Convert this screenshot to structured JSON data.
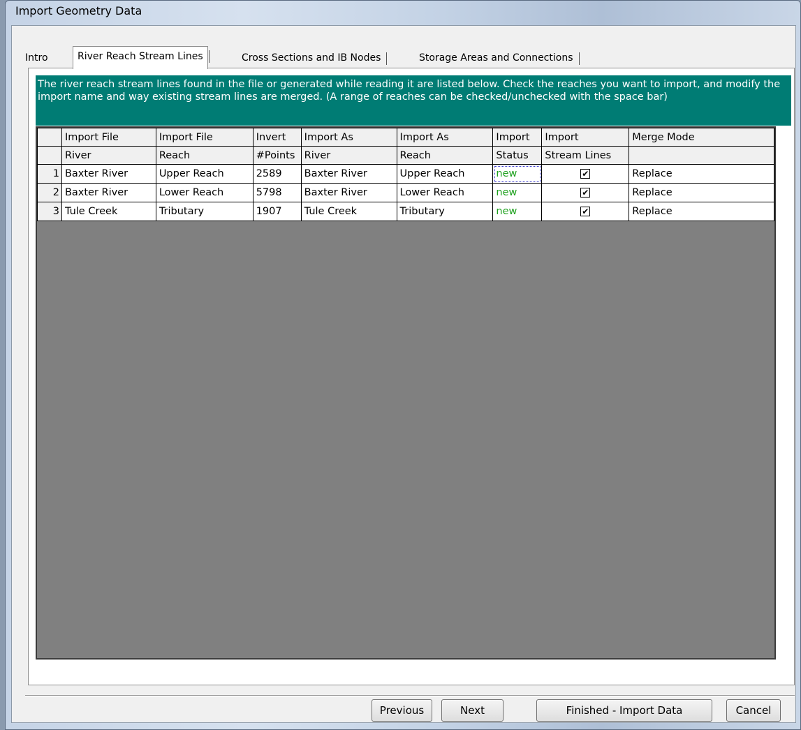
{
  "window": {
    "title": "Import Geometry Data"
  },
  "tabs": [
    {
      "label": "Intro"
    },
    {
      "label": "River Reach Stream Lines"
    },
    {
      "label": "Cross Sections and IB Nodes"
    },
    {
      "label": "Storage Areas and Connections"
    }
  ],
  "description": "The river reach stream lines found in the file or generated while reading it are listed below.  Check the reaches you want to import, and modify the import name and way existing stream lines are merged.  (A range of reaches can be checked/unchecked with the space bar)",
  "table": {
    "header1": [
      "Import File",
      "Import File",
      "Invert",
      "Import As",
      "Import As",
      "Import",
      "Import",
      "Merge Mode"
    ],
    "header2": [
      "River",
      "Reach",
      "#Points",
      "River",
      "Reach",
      "Status",
      "Stream Lines",
      ""
    ],
    "rows": [
      {
        "num": "1",
        "river": "Baxter River",
        "reach": "Upper Reach",
        "points": "2589",
        "as_river": "Baxter River",
        "as_reach": "Upper Reach",
        "status": "new",
        "import": true,
        "merge": "Replace"
      },
      {
        "num": "2",
        "river": "Baxter River",
        "reach": "Lower Reach",
        "points": "5798",
        "as_river": "Baxter River",
        "as_reach": "Lower Reach",
        "status": "new",
        "import": true,
        "merge": "Replace"
      },
      {
        "num": "3",
        "river": "Tule Creek",
        "reach": "Tributary",
        "points": "1907",
        "as_river": "Tule Creek",
        "as_reach": "Tributary",
        "status": "new",
        "import": true,
        "merge": "Replace"
      }
    ]
  },
  "buttons": {
    "previous": "Previous",
    "next": "Next",
    "finish": "Finished - Import Data",
    "cancel": "Cancel"
  },
  "colors": {
    "description_bg": "#007c74",
    "status_new": "#1ea11e",
    "grid_bg": "#808080"
  },
  "icons": {
    "checkbox": "checkmark-box-icon"
  }
}
